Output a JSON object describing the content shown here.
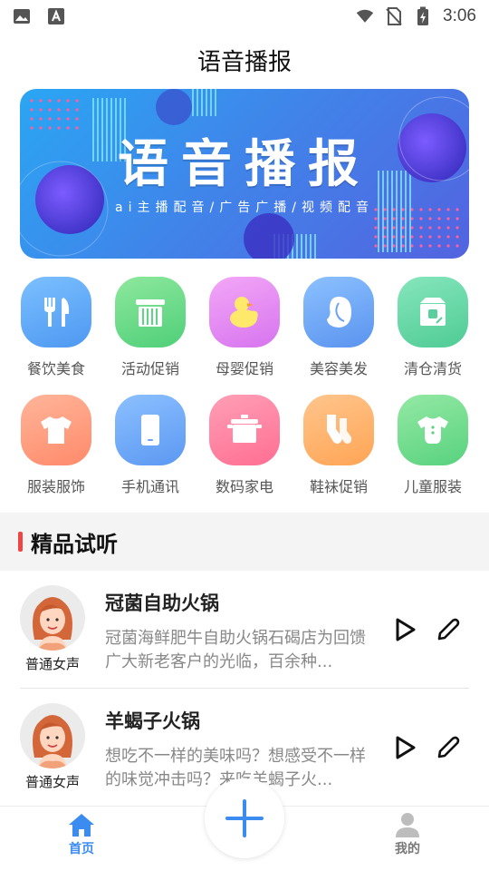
{
  "status_bar": {
    "time": "3:06",
    "icons": [
      "image-icon",
      "font-icon",
      "wifi-icon",
      "no-sim-icon",
      "battery-charging-icon"
    ]
  },
  "header": {
    "title": "语音播报"
  },
  "banner": {
    "title": "语音播报",
    "subtitle": "ai主播配音/广告广播/视频配音"
  },
  "categories": [
    {
      "label": "餐饮美食",
      "icon": "cutlery-icon",
      "color": "#5aa6f5"
    },
    {
      "label": "活动促销",
      "icon": "gift-box-icon",
      "color": "#6fd88a"
    },
    {
      "label": "母婴促销",
      "icon": "duck-icon",
      "color": "#e891f0"
    },
    {
      "label": "美容美发",
      "icon": "face-icon",
      "color": "#6aa9f6"
    },
    {
      "label": "清仓清货",
      "icon": "clearance-box-icon",
      "color": "#6bd7a8"
    },
    {
      "label": "服装服饰",
      "icon": "tshirt-icon",
      "color": "#ff9d80"
    },
    {
      "label": "手机通讯",
      "icon": "phone-icon",
      "color": "#6aa8f5"
    },
    {
      "label": "数码家电",
      "icon": "pot-icon",
      "color": "#ff7fa0"
    },
    {
      "label": "鞋袜促销",
      "icon": "sock-icon",
      "color": "#ffb470"
    },
    {
      "label": "儿童服装",
      "icon": "baby-clothes-icon",
      "color": "#72db8c"
    }
  ],
  "section": {
    "title": "精品试听"
  },
  "samples": [
    {
      "title": "冠菌自助火锅",
      "desc": "冠菌海鲜肥牛自助火锅石碣店为回馈广大新老客户的光临，百余种...",
      "voice": "普通女声"
    },
    {
      "title": "羊蝎子火锅",
      "desc": "想吃不一样的美味吗？想感受不一样的味觉冲击吗？来吃羊蝎子火...",
      "voice": "普通女声"
    }
  ],
  "bottom_nav": {
    "home_label": "首页",
    "me_label": "我的",
    "active_color": "#3b8cf0"
  }
}
